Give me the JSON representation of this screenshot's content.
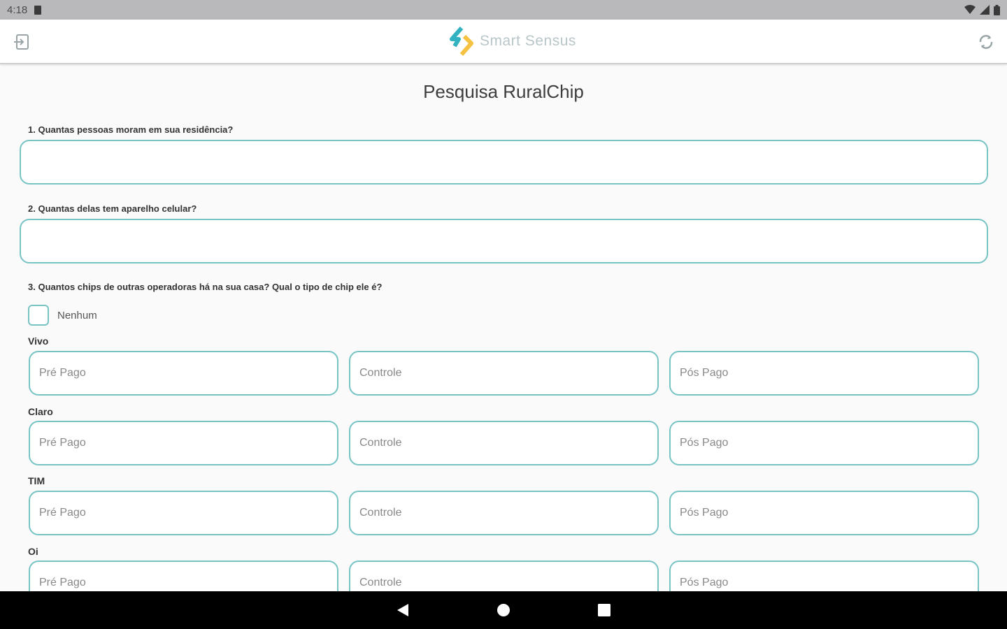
{
  "status_bar": {
    "time": "4:18",
    "icons": [
      "sim-icon",
      "wifi-icon",
      "signal-icon",
      "battery-icon"
    ]
  },
  "app_bar": {
    "brand": "Smart Sensus",
    "left_icon": "exit-icon",
    "right_icon": "sync-icon"
  },
  "form": {
    "title": "Pesquisa RuralChip",
    "q1": {
      "label": "1. Quantas pessoas moram em sua residência?",
      "value": ""
    },
    "q2": {
      "label": "2. Quantas delas tem aparelho celular?",
      "value": ""
    },
    "q3": {
      "label": "3. Quantos chips de outras operadoras há na sua casa? Qual o tipo de chip ele é?",
      "none_label": "Nenhum",
      "none_checked": false,
      "operators": [
        {
          "name": "Vivo",
          "pre": "Pré Pago",
          "controle": "Controle",
          "pos": "Pós Pago"
        },
        {
          "name": "Claro",
          "pre": "Pré Pago",
          "controle": "Controle",
          "pos": "Pós Pago"
        },
        {
          "name": "TIM",
          "pre": "Pré Pago",
          "controle": "Controle",
          "pos": "Pós Pago"
        },
        {
          "name": "Oi",
          "pre": "Pré Pago",
          "controle": "Controle",
          "pos": "Pós Pago"
        }
      ]
    }
  },
  "nav_bar": {
    "icons": [
      "back-icon",
      "home-icon",
      "recents-icon"
    ]
  },
  "colors": {
    "accent": "#78c3c4",
    "logo_teal": "#33b3c1",
    "logo_yellow": "#f5c242"
  }
}
